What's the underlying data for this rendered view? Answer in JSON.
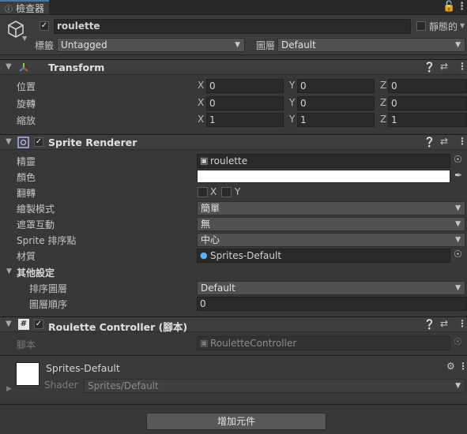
{
  "window": {
    "tab_title": "檢查器"
  },
  "object": {
    "name": "roulette",
    "active": true,
    "static_label": "靜態的",
    "tag_label": "標籤",
    "tag_value": "Untagged",
    "layer_label": "圖層",
    "layer_value": "Default"
  },
  "transform": {
    "title": "Transform",
    "rows": [
      {
        "label": "位置",
        "x": "0",
        "y": "0",
        "z": "0"
      },
      {
        "label": "旋轉",
        "x": "0",
        "y": "0",
        "z": "0"
      },
      {
        "label": "縮放",
        "x": "1",
        "y": "1",
        "z": "1"
      }
    ],
    "axis_x": "X",
    "axis_y": "Y",
    "axis_z": "Z"
  },
  "sprite_renderer": {
    "title": "Sprite Renderer",
    "sprite_label": "精靈",
    "sprite_value": "roulette",
    "color_label": "顏色",
    "color_value": "#ffffff",
    "flip_label": "翻轉",
    "flip_x": "X",
    "flip_y": "Y",
    "draw_mode_label": "繪製模式",
    "draw_mode_value": "簡單",
    "mask_label": "遮罩互動",
    "mask_value": "無",
    "sort_point_label": "Sprite 排序點",
    "sort_point_value": "中心",
    "material_label": "材質",
    "material_value": "Sprites-Default",
    "other_settings_label": "其他設定",
    "sorting_layer_label": "排序圖層",
    "sorting_layer_value": "Default",
    "order_label": "圖層順序",
    "order_value": "0"
  },
  "roulette_controller": {
    "title": "Roulette Controller (腳本)",
    "script_label": "腳本",
    "script_value": "RouletteController"
  },
  "material_preview": {
    "name": "Sprites-Default",
    "shader_label": "Shader",
    "shader_value": "Sprites/Default"
  },
  "add_component_label": "增加元件"
}
